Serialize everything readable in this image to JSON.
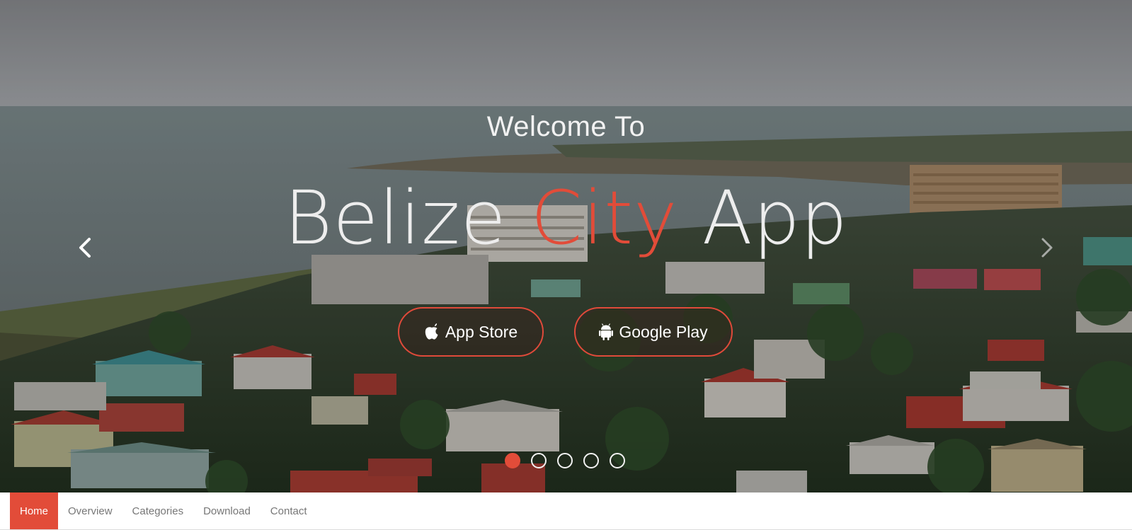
{
  "hero": {
    "welcome": "Welcome To",
    "headline": {
      "part1": "Belize ",
      "accent": "City",
      "part2": " App"
    },
    "buttons": {
      "appstore": {
        "label": "App Store",
        "icon": "apple-icon"
      },
      "googleplay": {
        "label": "Google Play",
        "icon": "android-icon"
      }
    },
    "carousel": {
      "slide_count": 5,
      "active_slide": 1
    }
  },
  "nav": {
    "items": [
      {
        "label": "Home",
        "active": true
      },
      {
        "label": "Overview",
        "active": false
      },
      {
        "label": "Categories",
        "active": false
      },
      {
        "label": "Download",
        "active": false
      },
      {
        "label": "Contact",
        "active": false
      }
    ]
  },
  "colors": {
    "accent": "#e24c39",
    "nav_text": "#777777",
    "hero_text": "#ededed"
  }
}
